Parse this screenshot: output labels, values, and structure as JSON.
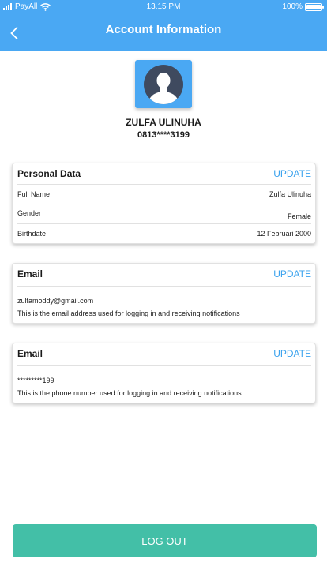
{
  "status_bar": {
    "carrier": "PayAll",
    "time": "13.15 PM",
    "battery": "100%",
    "battery_level": 1.0
  },
  "header": {
    "title": "Account Information"
  },
  "profile": {
    "name": "ZULFA ULINUHA",
    "phone": "0813****3199"
  },
  "personal_data": {
    "title": "Personal Data",
    "update_label": "UPDATE",
    "rows": [
      {
        "label": "Full Name",
        "value": "Zulfa Ulinuha"
      },
      {
        "label": "Gender",
        "value": "Female"
      },
      {
        "label": "Birthdate",
        "value": "12 Februari 2000"
      }
    ]
  },
  "email_card": {
    "title": "Email",
    "update_label": "UPDATE",
    "value": "zulfamoddy@gmail.com",
    "description": "This is the email address used for logging in and receiving notifications"
  },
  "phone_card": {
    "title": "Email",
    "update_label": "UPDATE",
    "value": "*********199",
    "description": "This is the phone number used for logging in and receiving notifications"
  },
  "logout": {
    "label": "LOG OUT"
  },
  "colors": {
    "primary": "#4aa8f3",
    "accent": "#43bfa7",
    "link": "#3aa2ee",
    "avatar_bg": "#3f4a5f"
  }
}
